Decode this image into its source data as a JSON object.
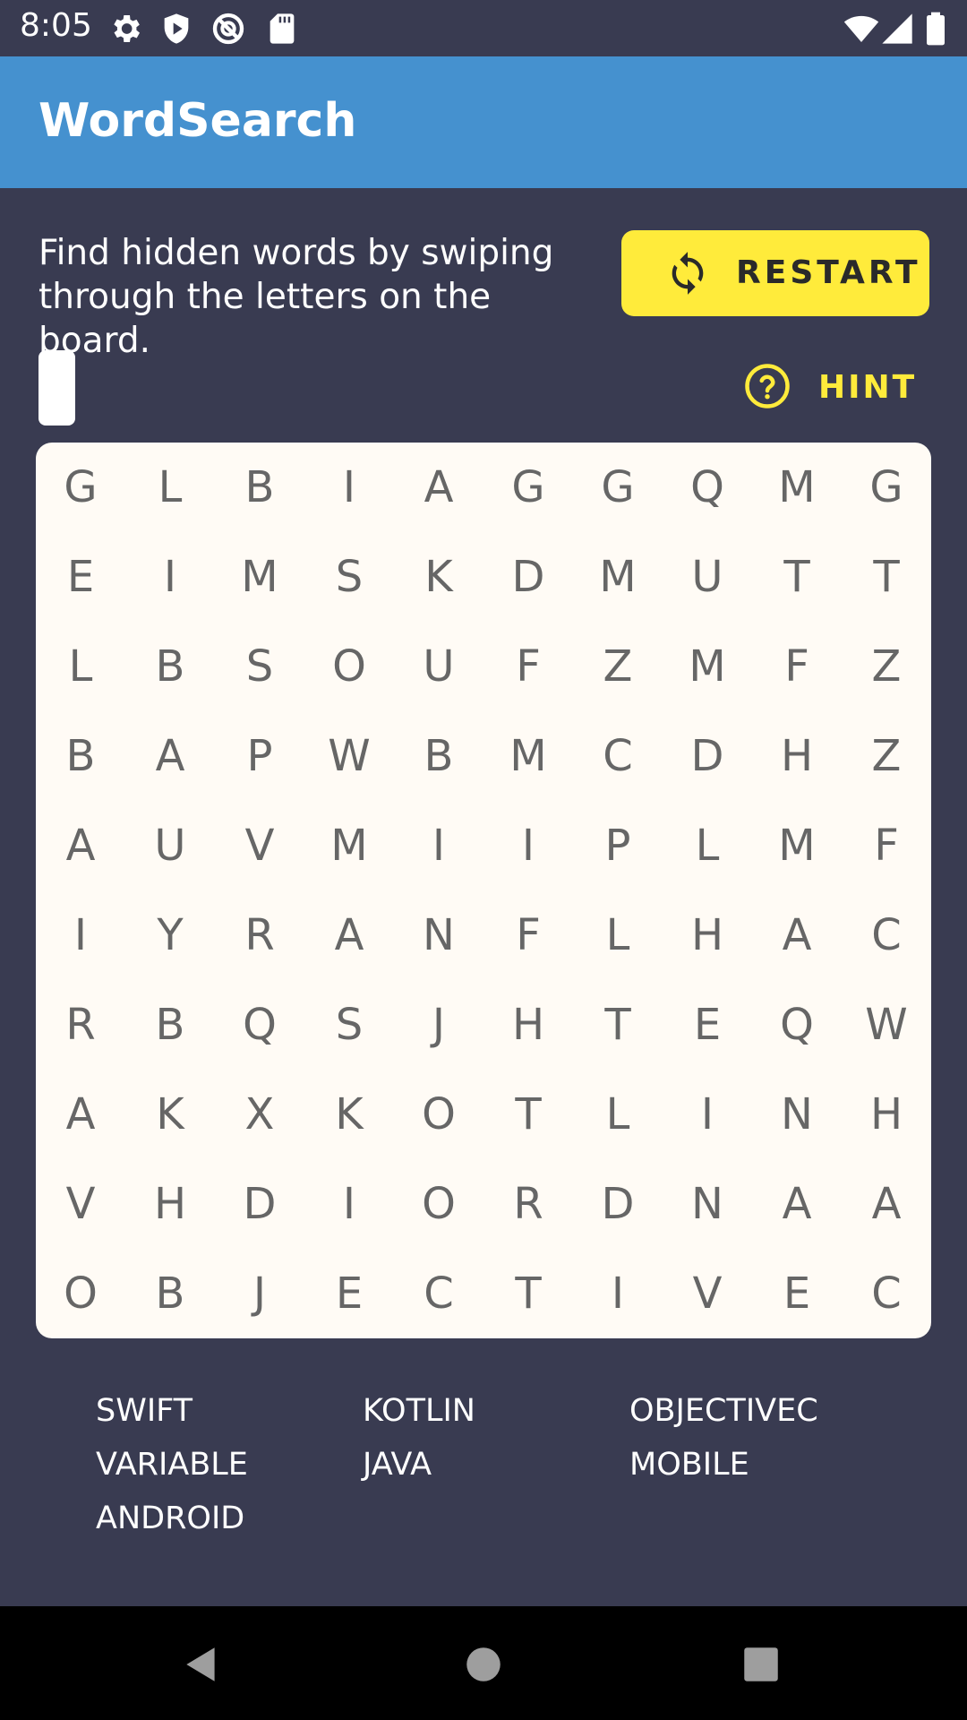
{
  "status_bar": {
    "time": "8:05",
    "icons": [
      "settings-icon",
      "shield-play-icon",
      "no-data-icon",
      "sd-card-icon",
      "wifi-icon",
      "signal-icon",
      "battery-icon"
    ]
  },
  "app_bar": {
    "title": "WordSearch"
  },
  "instruction": "Find hidden words by swiping through the letters on the board.",
  "restart": {
    "label": "RESTART",
    "icon": "refresh-icon"
  },
  "hint": {
    "label": "HINT",
    "icon": "help-circle-icon"
  },
  "current_word": "",
  "board": [
    [
      "G",
      "L",
      "B",
      "I",
      "A",
      "G",
      "G",
      "Q",
      "M",
      "G"
    ],
    [
      "E",
      "I",
      "M",
      "S",
      "K",
      "D",
      "M",
      "U",
      "T",
      "T"
    ],
    [
      "L",
      "B",
      "S",
      "O",
      "U",
      "F",
      "Z",
      "M",
      "F",
      "Z"
    ],
    [
      "B",
      "A",
      "P",
      "W",
      "B",
      "M",
      "C",
      "D",
      "H",
      "Z"
    ],
    [
      "A",
      "U",
      "V",
      "M",
      "I",
      "I",
      "P",
      "L",
      "M",
      "F"
    ],
    [
      "I",
      "Y",
      "R",
      "A",
      "N",
      "F",
      "L",
      "H",
      "A",
      "C"
    ],
    [
      "R",
      "B",
      "Q",
      "S",
      "J",
      "H",
      "T",
      "E",
      "Q",
      "W"
    ],
    [
      "A",
      "K",
      "X",
      "K",
      "O",
      "T",
      "L",
      "I",
      "N",
      "H"
    ],
    [
      "V",
      "H",
      "D",
      "I",
      "O",
      "R",
      "D",
      "N",
      "A",
      "A"
    ],
    [
      "O",
      "B",
      "J",
      "E",
      "C",
      "T",
      "I",
      "V",
      "E",
      "C"
    ]
  ],
  "words": [
    "SWIFT",
    "KOTLIN",
    "OBJECTIVEC",
    "VARIABLE",
    "JAVA",
    "MOBILE",
    "ANDROID"
  ],
  "colors": {
    "background": "#393B51",
    "app_bar": "#4591CF",
    "accent": "#FFEB3B",
    "board": "#FFFBF5",
    "letter": "#666666"
  },
  "nav_bar": {
    "buttons": [
      "back-icon",
      "home-icon",
      "recents-icon"
    ]
  }
}
